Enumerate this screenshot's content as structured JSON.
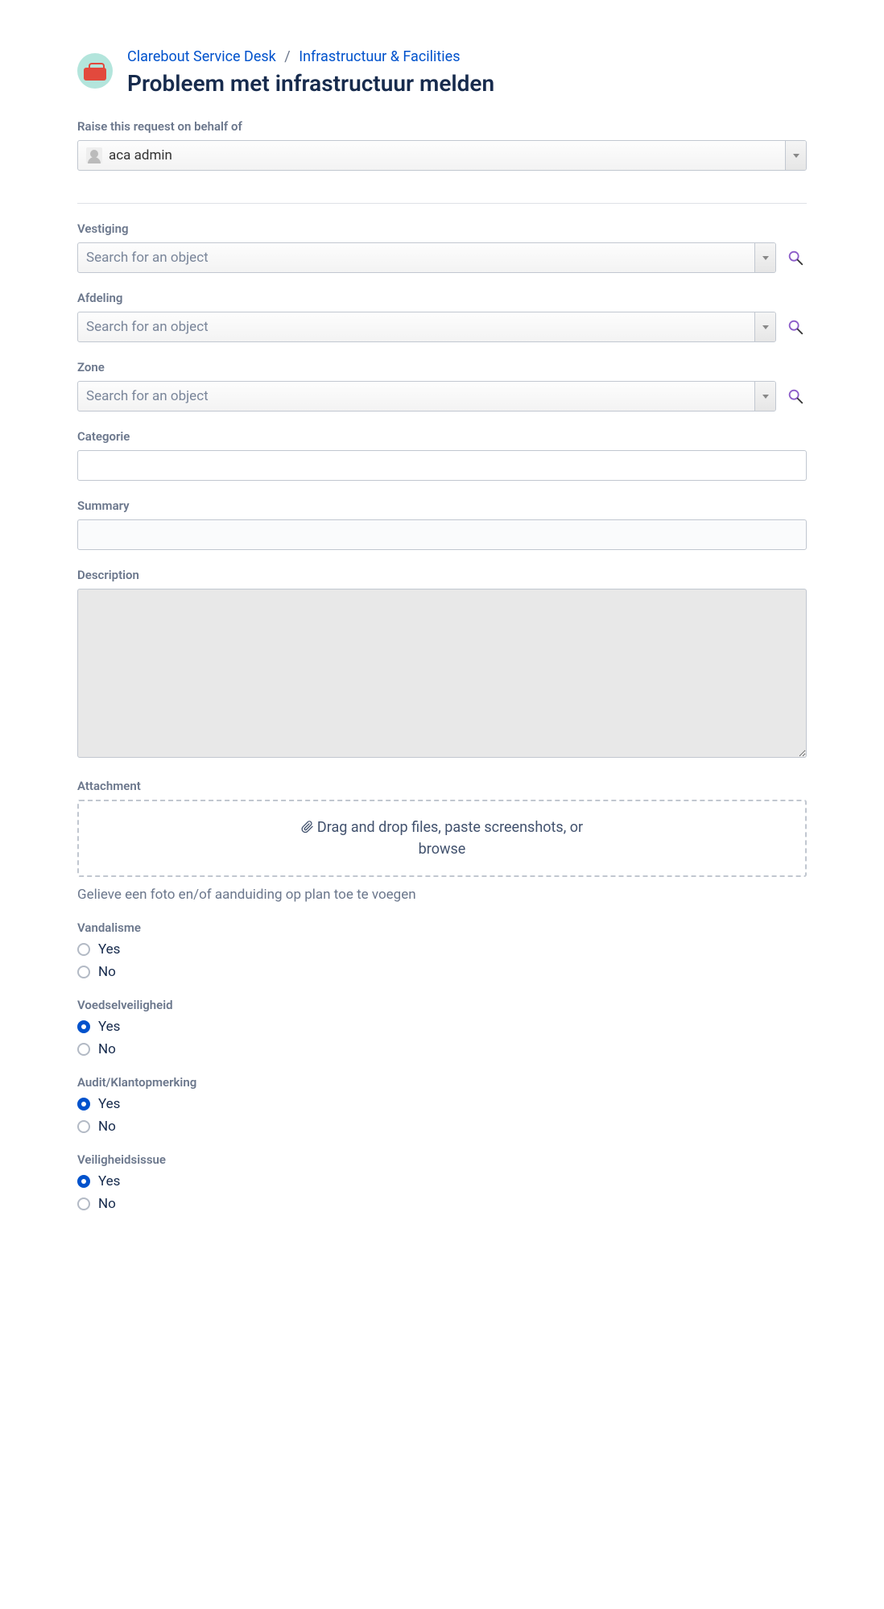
{
  "breadcrumb": {
    "portal": "Clarebout Service Desk",
    "category": "Infrastructuur & Facilities"
  },
  "title": "Probleem met infrastructuur melden",
  "requester": {
    "label": "Raise this request on behalf of",
    "value": "aca admin"
  },
  "fields": {
    "vestiging": {
      "label": "Vestiging",
      "placeholder": "Search for an object"
    },
    "afdeling": {
      "label": "Afdeling",
      "placeholder": "Search for an object"
    },
    "zone": {
      "label": "Zone",
      "placeholder": "Search for an object"
    },
    "categorie": {
      "label": "Categorie"
    },
    "summary": {
      "label": "Summary"
    },
    "description": {
      "label": "Description"
    },
    "attachment": {
      "label": "Attachment",
      "dropText": "Drag and drop files, paste screenshots, or",
      "browse": "browse",
      "hint": "Gelieve een foto en/of aanduiding op plan toe te voegen"
    }
  },
  "radios": {
    "vandalisme": {
      "label": "Vandalisme",
      "yes": "Yes",
      "no": "No",
      "selected": null
    },
    "voedselveiligheid": {
      "label": "Voedselveiligheid",
      "yes": "Yes",
      "no": "No",
      "selected": "yes"
    },
    "audit": {
      "label": "Audit/Klantopmerking",
      "yes": "Yes",
      "no": "No",
      "selected": "yes"
    },
    "veiligheidsissue": {
      "label": "Veiligheidsissue",
      "yes": "Yes",
      "no": "No",
      "selected": "yes"
    }
  }
}
